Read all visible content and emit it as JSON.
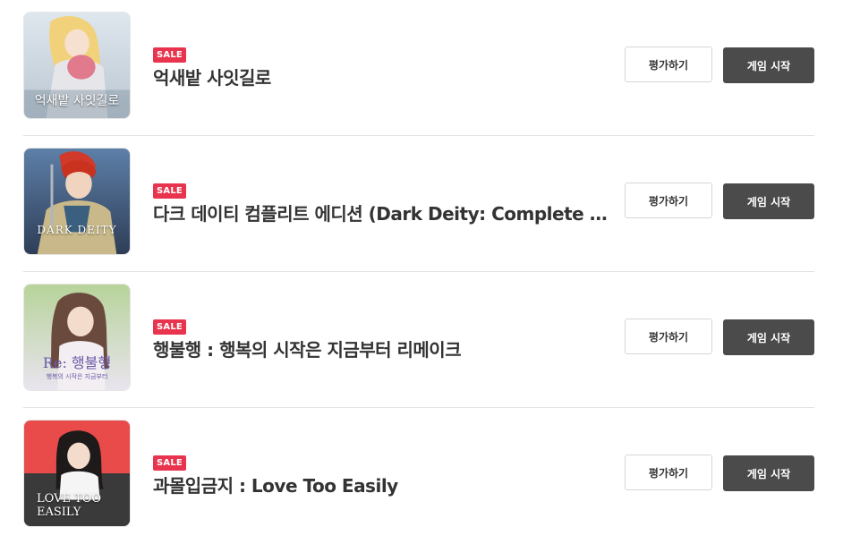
{
  "colors": {
    "sale_badge": "#e8344e",
    "play_button": "#4b4b4b",
    "divider": "#e2e2e2"
  },
  "games": [
    {
      "sale_label": "SALE",
      "title": "억새밭 사잇길로",
      "thumb_text": "억새밭 사잇길로",
      "rate_label": "평가하기",
      "play_label": "게임 시작"
    },
    {
      "sale_label": "SALE",
      "title": "다크 데이티 컴플리트 에디션 (Dark Deity: Complete Edition)",
      "thumb_text": "DARK DEITY",
      "rate_label": "평가하기",
      "play_label": "게임 시작"
    },
    {
      "sale_label": "SALE",
      "title": "행불행 : 행복의 시작은 지금부터 리메이크",
      "thumb_text": "Re: 행불행",
      "thumb_sub": "행복의 시작은 지금부터",
      "rate_label": "평가하기",
      "play_label": "게임 시작"
    },
    {
      "sale_label": "SALE",
      "title": "과몰입금지 : Love Too Easily",
      "thumb_text": "LOVE TOO EASILY",
      "rate_label": "평가하기",
      "play_label": "게임 시작"
    }
  ]
}
